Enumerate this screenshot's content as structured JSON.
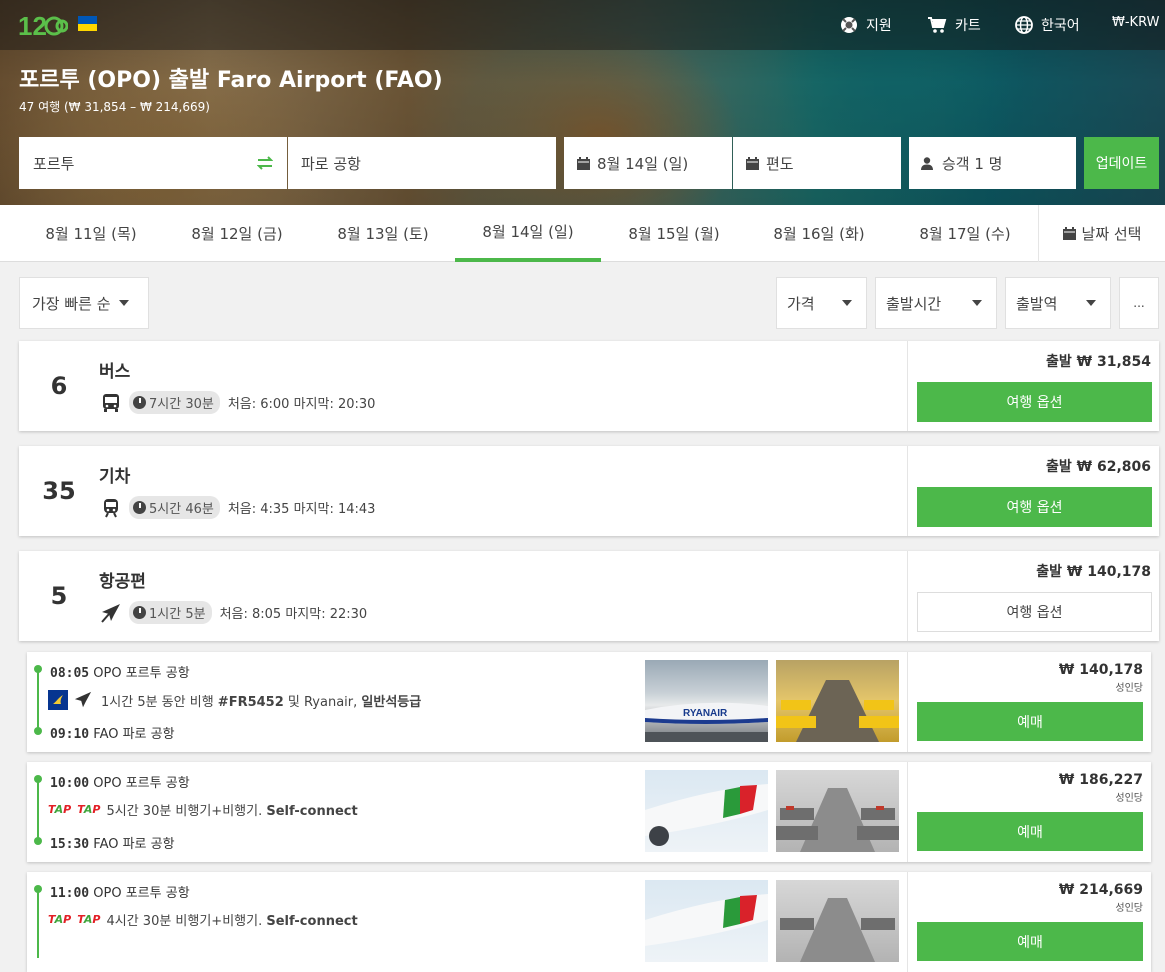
{
  "nav": {
    "support": "지원",
    "cart": "카트",
    "language": "한국어",
    "currency": "₩-KRW",
    "flag_colors": [
      "#0057b7",
      "#ffd700"
    ]
  },
  "header": {
    "title": "포르투 (OPO) 출발 Faro Airport (FAO)",
    "subtitle": "47 여행 (₩ 31,854 – ₩ 214,669)"
  },
  "search": {
    "from": "포르투",
    "to": "파로 공항",
    "date": "8월 14일 (일)",
    "return": "편도",
    "passengers": "승객 1 명",
    "update_label": "업데이트"
  },
  "dates": [
    {
      "label": "8월 11일 (목)",
      "active": false
    },
    {
      "label": "8월 12일 (금)",
      "active": false
    },
    {
      "label": "8월 13일 (토)",
      "active": false
    },
    {
      "label": "8월 14일 (일)",
      "active": true
    },
    {
      "label": "8월 15일 (월)",
      "active": false
    },
    {
      "label": "8월 16일 (화)",
      "active": false
    },
    {
      "label": "8월 17일 (수)",
      "active": false
    }
  ],
  "date_picker_label": "날짜 선택",
  "filters": {
    "sort": "가장 빠른 순",
    "price": "가격",
    "departure_time": "출발시간",
    "departure_station": "출발역",
    "more": "..."
  },
  "categories": [
    {
      "count": "6",
      "mode": "버스",
      "icon": "bus-icon",
      "duration": "7시간 30분",
      "times": "처음: 6:00 마지막: 20:30",
      "price": "출발 ₩ 31,854",
      "button": "여행 옵션",
      "expanded": false
    },
    {
      "count": "35",
      "mode": "기차",
      "icon": "train-icon",
      "duration": "5시간 46분",
      "times": "처음: 4:35 마지막: 14:43",
      "price": "출발 ₩ 62,806",
      "button": "여행 옵션",
      "expanded": false
    },
    {
      "count": "5",
      "mode": "항공편",
      "icon": "plane-icon",
      "duration": "1시간 5분",
      "times": "처음: 8:05 마지막: 22:30",
      "price": "출발 ₩ 140,178",
      "button": "여행 옵션",
      "expanded": true
    }
  ],
  "trips": [
    {
      "dep_time": "08:05",
      "dep_place": "OPO 포르투 공항",
      "arr_time": "09:10",
      "arr_place": "FAO 파로 공항",
      "desc_plain": "1시간 5분 동안 비행 ",
      "desc_bold": "#FR5452",
      "desc_rest": " 및 Ryanair, ",
      "desc_bold2": "일반석등급",
      "carrier": "Ryanair",
      "price": "₩ 140,178",
      "per": "성인당",
      "button": "예매"
    },
    {
      "dep_time": "10:00",
      "dep_place": "OPO 포르투 공항",
      "arr_time": "15:30",
      "arr_place": "FAO 파로 공항",
      "desc_plain": "5시간 30분 비행기+비행기. ",
      "desc_bold": "Self-connect",
      "carrier": "TAP",
      "price": "₩ 186,227",
      "per": "성인당",
      "button": "예매"
    },
    {
      "dep_time": "11:00",
      "dep_place": "OPO 포르투 공항",
      "desc_plain": "4시간 30분 비행기+비행기. ",
      "desc_bold": "Self-connect",
      "carrier": "TAP",
      "price": "₩ 214,669",
      "per": "성인당",
      "button": "예매"
    }
  ],
  "tap_logo_text": "TAP"
}
